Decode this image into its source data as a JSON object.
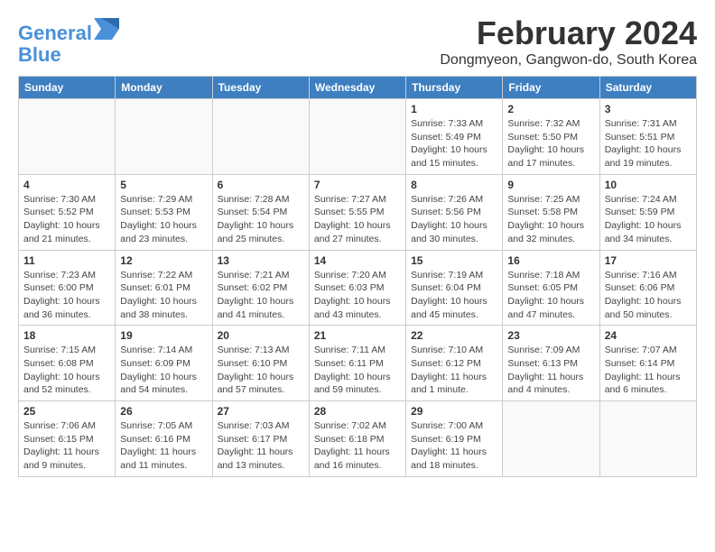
{
  "logo": {
    "line1": "General",
    "line2": "Blue"
  },
  "title": "February 2024",
  "subtitle": "Dongmyeon, Gangwon-do, South Korea",
  "days_of_week": [
    "Sunday",
    "Monday",
    "Tuesday",
    "Wednesday",
    "Thursday",
    "Friday",
    "Saturday"
  ],
  "weeks": [
    [
      {
        "day": "",
        "info": ""
      },
      {
        "day": "",
        "info": ""
      },
      {
        "day": "",
        "info": ""
      },
      {
        "day": "",
        "info": ""
      },
      {
        "day": "1",
        "info": "Sunrise: 7:33 AM\nSunset: 5:49 PM\nDaylight: 10 hours\nand 15 minutes."
      },
      {
        "day": "2",
        "info": "Sunrise: 7:32 AM\nSunset: 5:50 PM\nDaylight: 10 hours\nand 17 minutes."
      },
      {
        "day": "3",
        "info": "Sunrise: 7:31 AM\nSunset: 5:51 PM\nDaylight: 10 hours\nand 19 minutes."
      }
    ],
    [
      {
        "day": "4",
        "info": "Sunrise: 7:30 AM\nSunset: 5:52 PM\nDaylight: 10 hours\nand 21 minutes."
      },
      {
        "day": "5",
        "info": "Sunrise: 7:29 AM\nSunset: 5:53 PM\nDaylight: 10 hours\nand 23 minutes."
      },
      {
        "day": "6",
        "info": "Sunrise: 7:28 AM\nSunset: 5:54 PM\nDaylight: 10 hours\nand 25 minutes."
      },
      {
        "day": "7",
        "info": "Sunrise: 7:27 AM\nSunset: 5:55 PM\nDaylight: 10 hours\nand 27 minutes."
      },
      {
        "day": "8",
        "info": "Sunrise: 7:26 AM\nSunset: 5:56 PM\nDaylight: 10 hours\nand 30 minutes."
      },
      {
        "day": "9",
        "info": "Sunrise: 7:25 AM\nSunset: 5:58 PM\nDaylight: 10 hours\nand 32 minutes."
      },
      {
        "day": "10",
        "info": "Sunrise: 7:24 AM\nSunset: 5:59 PM\nDaylight: 10 hours\nand 34 minutes."
      }
    ],
    [
      {
        "day": "11",
        "info": "Sunrise: 7:23 AM\nSunset: 6:00 PM\nDaylight: 10 hours\nand 36 minutes."
      },
      {
        "day": "12",
        "info": "Sunrise: 7:22 AM\nSunset: 6:01 PM\nDaylight: 10 hours\nand 38 minutes."
      },
      {
        "day": "13",
        "info": "Sunrise: 7:21 AM\nSunset: 6:02 PM\nDaylight: 10 hours\nand 41 minutes."
      },
      {
        "day": "14",
        "info": "Sunrise: 7:20 AM\nSunset: 6:03 PM\nDaylight: 10 hours\nand 43 minutes."
      },
      {
        "day": "15",
        "info": "Sunrise: 7:19 AM\nSunset: 6:04 PM\nDaylight: 10 hours\nand 45 minutes."
      },
      {
        "day": "16",
        "info": "Sunrise: 7:18 AM\nSunset: 6:05 PM\nDaylight: 10 hours\nand 47 minutes."
      },
      {
        "day": "17",
        "info": "Sunrise: 7:16 AM\nSunset: 6:06 PM\nDaylight: 10 hours\nand 50 minutes."
      }
    ],
    [
      {
        "day": "18",
        "info": "Sunrise: 7:15 AM\nSunset: 6:08 PM\nDaylight: 10 hours\nand 52 minutes."
      },
      {
        "day": "19",
        "info": "Sunrise: 7:14 AM\nSunset: 6:09 PM\nDaylight: 10 hours\nand 54 minutes."
      },
      {
        "day": "20",
        "info": "Sunrise: 7:13 AM\nSunset: 6:10 PM\nDaylight: 10 hours\nand 57 minutes."
      },
      {
        "day": "21",
        "info": "Sunrise: 7:11 AM\nSunset: 6:11 PM\nDaylight: 10 hours\nand 59 minutes."
      },
      {
        "day": "22",
        "info": "Sunrise: 7:10 AM\nSunset: 6:12 PM\nDaylight: 11 hours\nand 1 minute."
      },
      {
        "day": "23",
        "info": "Sunrise: 7:09 AM\nSunset: 6:13 PM\nDaylight: 11 hours\nand 4 minutes."
      },
      {
        "day": "24",
        "info": "Sunrise: 7:07 AM\nSunset: 6:14 PM\nDaylight: 11 hours\nand 6 minutes."
      }
    ],
    [
      {
        "day": "25",
        "info": "Sunrise: 7:06 AM\nSunset: 6:15 PM\nDaylight: 11 hours\nand 9 minutes."
      },
      {
        "day": "26",
        "info": "Sunrise: 7:05 AM\nSunset: 6:16 PM\nDaylight: 11 hours\nand 11 minutes."
      },
      {
        "day": "27",
        "info": "Sunrise: 7:03 AM\nSunset: 6:17 PM\nDaylight: 11 hours\nand 13 minutes."
      },
      {
        "day": "28",
        "info": "Sunrise: 7:02 AM\nSunset: 6:18 PM\nDaylight: 11 hours\nand 16 minutes."
      },
      {
        "day": "29",
        "info": "Sunrise: 7:00 AM\nSunset: 6:19 PM\nDaylight: 11 hours\nand 18 minutes."
      },
      {
        "day": "",
        "info": ""
      },
      {
        "day": "",
        "info": ""
      }
    ]
  ]
}
